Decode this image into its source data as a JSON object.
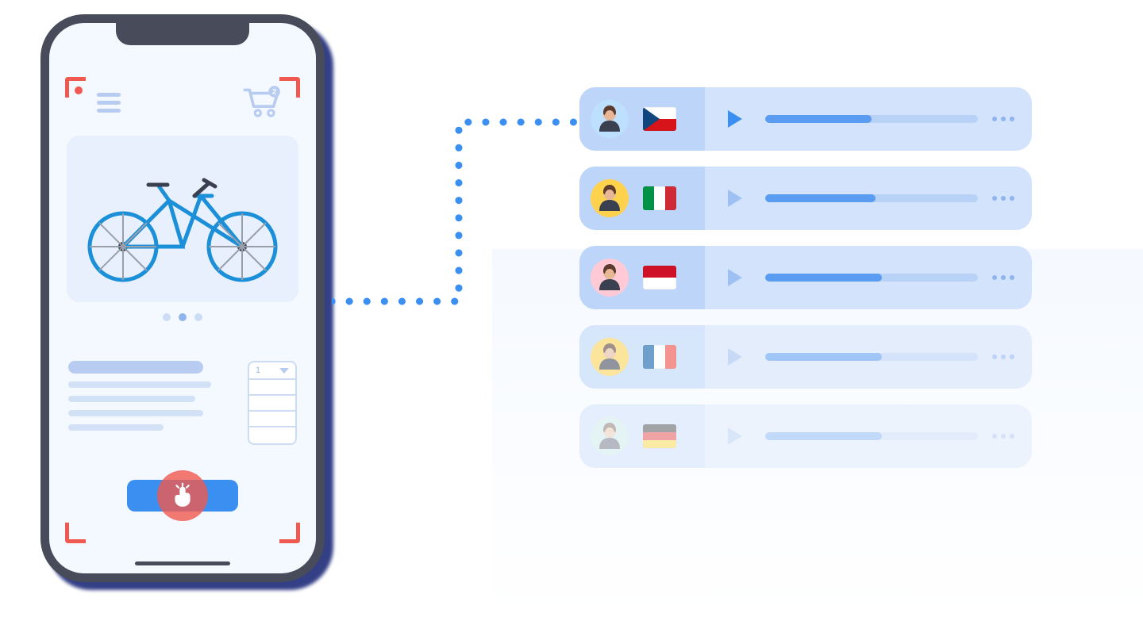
{
  "phone": {
    "header": {
      "cart_badge": "2"
    },
    "product": {
      "image": "bicycle",
      "pager_count": 3,
      "pager_active_index": 1
    },
    "quantity": {
      "selected": "1",
      "option_rows": 4
    },
    "cta_label": "",
    "recording": true
  },
  "testers": [
    {
      "avatar_bg": "av-blue",
      "flag": "flag-cz",
      "country": "Czech Republic",
      "active": true,
      "progress": 0.5,
      "fade": 0
    },
    {
      "avatar_bg": "av-yellow",
      "flag": "flag-it",
      "country": "Italy",
      "active": false,
      "progress": 0.52,
      "fade": 0
    },
    {
      "avatar_bg": "av-pink",
      "flag": "flag-id",
      "country": "Indonesia",
      "active": false,
      "progress": 0.55,
      "fade": 0
    },
    {
      "avatar_bg": "av-yellow",
      "flag": "flag-fr",
      "country": "France",
      "active": false,
      "progress": 0.55,
      "fade": 1
    },
    {
      "avatar_bg": "av-teal",
      "flag": "flag-de",
      "country": "Germany",
      "active": false,
      "progress": 0.55,
      "fade": 2
    }
  ]
}
